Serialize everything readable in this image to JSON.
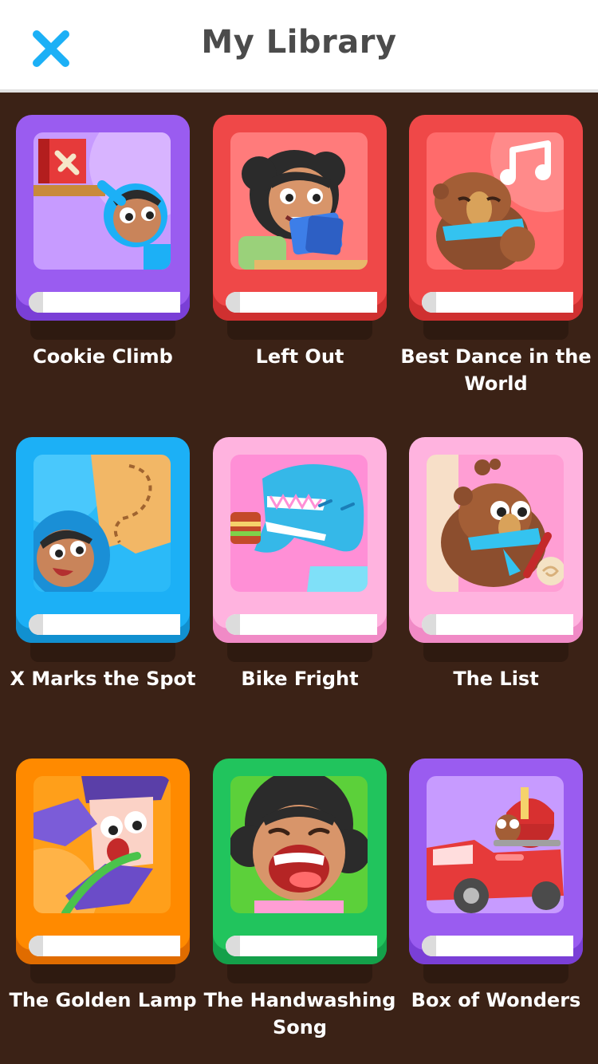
{
  "header": {
    "title": "My Library",
    "close_icon": "close-icon"
  },
  "colors": {
    "background": "#3b2216",
    "accent": "#1cb0f6",
    "purple": "#9a5cf0",
    "red": "#f05a5a",
    "blue": "#1cb0f6",
    "pink": "#ffb7e0",
    "orange": "#ff9500",
    "green": "#21c45d"
  },
  "books": [
    {
      "title": "Cookie Climb",
      "color": "purple",
      "cover_icon": "cookie-climb-cover"
    },
    {
      "title": "Left Out",
      "color": "red",
      "cover_icon": "left-out-cover"
    },
    {
      "title": "Best Dance in the World",
      "color": "red",
      "cover_icon": "best-dance-cover"
    },
    {
      "title": "X Marks the Spot",
      "color": "blue",
      "cover_icon": "x-marks-the-spot-cover"
    },
    {
      "title": "Bike Fright",
      "color": "pink",
      "cover_icon": "bike-fright-cover"
    },
    {
      "title": "The List",
      "color": "pink",
      "cover_icon": "the-list-cover"
    },
    {
      "title": "The Golden Lamp",
      "color": "orange",
      "cover_icon": "golden-lamp-cover"
    },
    {
      "title": "The Handwashing Song",
      "color": "green",
      "cover_icon": "handwashing-song-cover"
    },
    {
      "title": "Box of Wonders",
      "color": "purple",
      "cover_icon": "box-of-wonders-cover"
    }
  ]
}
